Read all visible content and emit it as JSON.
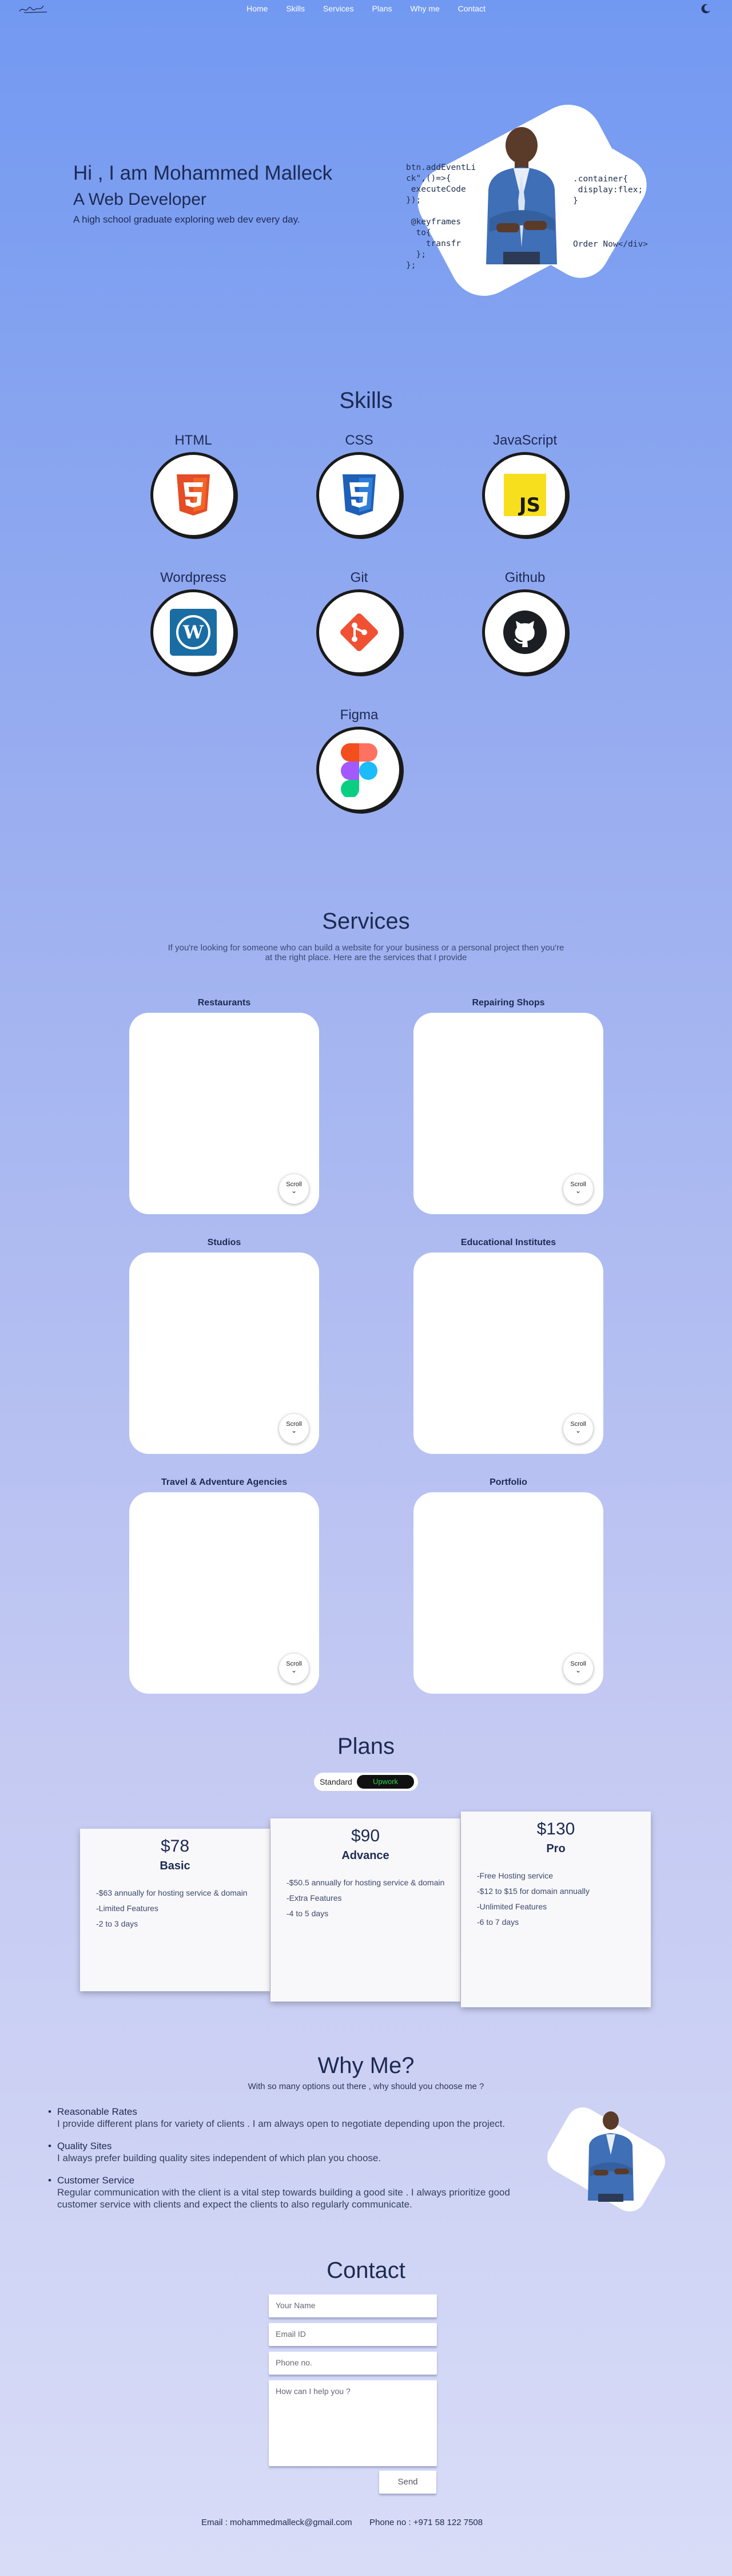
{
  "nav": {
    "links": [
      "Home",
      "Skills",
      "Services",
      "Plans",
      "Why me",
      "Contact"
    ]
  },
  "hero": {
    "greeting": "Hi , I am Mohammed Malleck",
    "role": "A Web Developer",
    "tagline": "A high school graduate exploring web dev every day.",
    "code_left": "btn.addEventLi\nck\",()=>{\n executeCode\n});\n\n @keyframes\n  to{\n    transfr\n  };\n};",
    "code_right": ".container{\n display:flex;\n}\n\n\n\nOrder Now</div>"
  },
  "skills": {
    "title": "Skills",
    "items": [
      {
        "label": "HTML",
        "icon": "html5-icon"
      },
      {
        "label": "CSS",
        "icon": "css3-icon"
      },
      {
        "label": "JavaScript",
        "icon": "javascript-icon"
      },
      {
        "label": "Wordpress",
        "icon": "wordpress-icon"
      },
      {
        "label": "Git",
        "icon": "git-icon"
      },
      {
        "label": "Github",
        "icon": "github-icon"
      },
      {
        "label": "Figma",
        "icon": "figma-icon"
      }
    ]
  },
  "services": {
    "title": "Services",
    "intro_line1": "If you're looking for someone who can build a website for your business or a personal project then you're",
    "intro_line2": "at the right place. Here are the services that I provide",
    "scroll_label": "Scroll",
    "items": [
      "Restaurants",
      "Repairing Shops",
      "Studios",
      "Educational Institutes",
      "Travel & Adventure Agencies",
      "Portfolio"
    ]
  },
  "plans": {
    "title": "Plans",
    "toggle_left": "Standard",
    "toggle_right": "Upwork",
    "items": [
      {
        "price": "$78",
        "name": "Basic",
        "features": [
          "-$63 annually for hosting service & domain",
          "-Limited Features",
          "-2 to 3 days"
        ]
      },
      {
        "price": "$90",
        "name": "Advance",
        "features": [
          "-$50.5 annually for hosting service & domain",
          "-Extra Features",
          "-4 to 5 days"
        ]
      },
      {
        "price": "$130",
        "name": "Pro",
        "features": [
          "-Free Hosting service",
          "-$12 to $15 for domain  annually",
          "-Unlimited Features",
          "-6 to 7 days"
        ]
      }
    ]
  },
  "why": {
    "title": "Why Me?",
    "subtitle": "With so many options out there , why should you choose me ?",
    "points": [
      {
        "heading": "Reasonable Rates",
        "text": "I provide different plans for variety of clients . I am always open to negotiate depending upon the project."
      },
      {
        "heading": "Quality Sites",
        "text": "I always prefer building quality sites independent of which plan you choose."
      },
      {
        "heading": "Customer Service",
        "text": "Regular communication with the client is a vital step towards building a good site . I always prioritize good customer service with clients and expect the clients to also regularly communicate."
      }
    ]
  },
  "contact": {
    "title": "Contact",
    "name_placeholder": "Your Name",
    "email_placeholder": "Email ID",
    "phone_placeholder": "Phone no.",
    "message_placeholder": "How can I help you ?",
    "send_label": "Send",
    "email_info": "Email : mohammedmalleck@gmail.com",
    "phone_info": "Phone no : +971 58 122 7508"
  }
}
